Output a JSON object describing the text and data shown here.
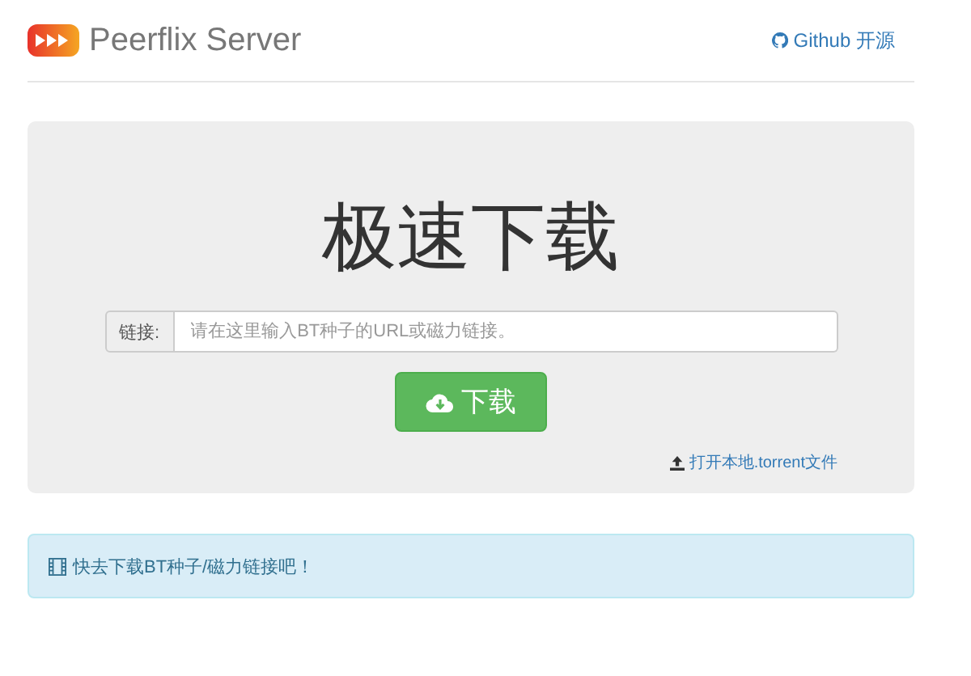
{
  "header": {
    "title": "Peerflix Server",
    "github_link": "Github 开源"
  },
  "hero": {
    "title": "极速下载",
    "input_label": "链接:",
    "placeholder": "请在这里输入BT种子的URL或磁力链接。",
    "download_button": "下载",
    "open_file_link": "打开本地.torrent文件"
  },
  "alert": {
    "text": "快去下载BT种子/磁力链接吧！"
  }
}
